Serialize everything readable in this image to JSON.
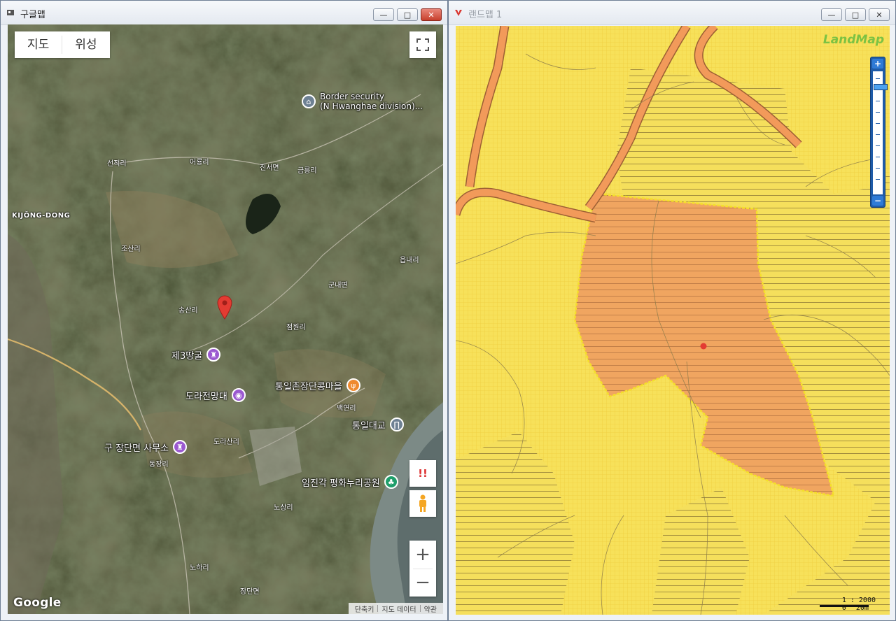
{
  "left_window": {
    "title": "구글맵",
    "map_type_tabs": [
      "지도",
      "위성"
    ],
    "labels": {
      "kijong": "KIJŎNG-DONG",
      "border1": "Border security",
      "border2": "(N Hwanghae division)...",
      "seonjeok": "선적리",
      "eoryong": "어룡리",
      "jinseo": "진서면",
      "geumreung": "금릉리",
      "josan": "조산리",
      "eupnae": "읍내리",
      "gunnae": "군내면",
      "songsan": "송산리",
      "jeomwon": "점원리",
      "baekyeon": "백연리",
      "dorasan": "도라산리",
      "dongjang": "동장리",
      "nosang": "노상리",
      "noha": "노하리",
      "jangdan": "장단면"
    },
    "pois": {
      "tunnel": "제3땅굴",
      "dora": "도라전망대",
      "tongil_village": "통일촌장단콩마을",
      "tongil_bridge": "통일대교",
      "old_office": "구 장단면 사무소",
      "imjingak": "임진각 평화누리공원"
    },
    "footer": [
      "단축키",
      "지도 데이터",
      "약관"
    ],
    "brand": "Google",
    "controls": {
      "zoom_in": "+",
      "zoom_out": "−",
      "alert": "!!"
    }
  },
  "right_window": {
    "title": "랜드맵 1",
    "logo": "LandMap",
    "scale_ratio": "1 : 2000",
    "scale_left": "0",
    "scale_right": "20m"
  },
  "window_buttons": {
    "minimize": "—",
    "maximize": "□",
    "close": "✕"
  },
  "colors": {
    "parcel_fill": "#f0a560",
    "base_yellow": "#f7e15a",
    "road": "#f29a5a",
    "marker": "#e33b32"
  }
}
